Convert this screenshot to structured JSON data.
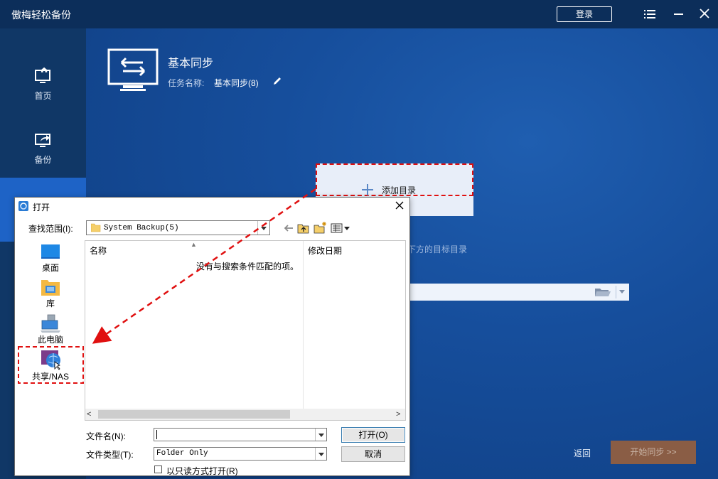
{
  "app": {
    "title": "傲梅轻松备份",
    "login_label": "登录"
  },
  "sidebar": {
    "items": [
      {
        "label": "首页",
        "icon": "home-monitor-icon"
      },
      {
        "label": "备份",
        "icon": "backup-monitor-icon"
      },
      {
        "label": "",
        "icon": "sync-icon",
        "active": true
      }
    ]
  },
  "task": {
    "title": "基本同步",
    "name_label": "任务名称:",
    "name_value": "基本同步(8)"
  },
  "sync": {
    "add_dir_label": "添加目录",
    "target_hint": "下方的目标目录",
    "back_label": "返回",
    "start_label": "开始同步 >>"
  },
  "dialog": {
    "title": "打开",
    "lookin_label": "查找范围(I):",
    "lookin_value": "System Backup(5)",
    "places": [
      "桌面",
      "库",
      "此电脑",
      "共享/NAS"
    ],
    "columns": {
      "name": "名称",
      "date": "修改日期"
    },
    "empty_message": "没有与搜索条件匹配的项。",
    "filename_label": "文件名(N):",
    "filename_value": "",
    "filetype_label": "文件类型(T):",
    "filetype_value": "Folder Only",
    "open_label": "打开(O)",
    "cancel_label": "取消",
    "readonly_label": "以只读方式打开(R)",
    "readonly_checked": false
  },
  "colors": {
    "titlebar": "#0c2e5a",
    "sidebar": "#103766",
    "sidebar_active": "#1e63c6",
    "main_bg": "#164e9c",
    "start_button": "#8a5d45",
    "annotation": "#e01010"
  }
}
